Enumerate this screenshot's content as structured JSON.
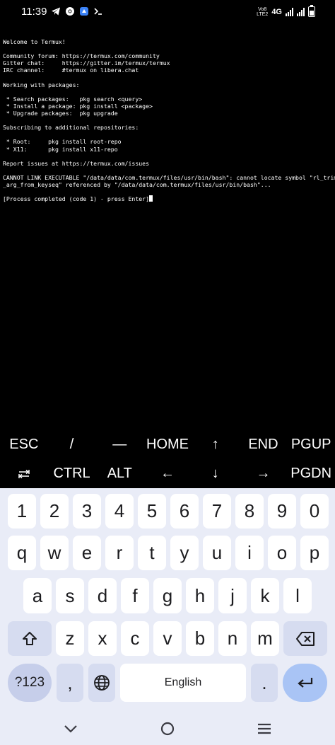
{
  "status_bar": {
    "time": "11:39",
    "volte_top": "Vo8",
    "volte_bottom": "LTE2",
    "network": "4G",
    "icons": [
      "telegram-icon",
      "chrome-icon",
      "app-store-icon",
      "termux-prompt-icon"
    ]
  },
  "terminal": {
    "lines": [
      "",
      "Welcome to Termux!",
      "",
      "Community forum: https://termux.com/community",
      "Gitter chat:     https://gitter.im/termux/termux",
      "IRC channel:     #termux on libera.chat",
      "",
      "Working with packages:",
      "",
      " * Search packages:   pkg search <query>",
      " * Install a package: pkg install <package>",
      " * Upgrade packages:  pkg upgrade",
      "",
      "Subscribing to additional repositories:",
      "",
      " * Root:     pkg install root-repo",
      " * X11:      pkg install x11-repo",
      "",
      "Report issues at https://termux.com/issues",
      "",
      "CANNOT LINK EXECUTABLE \"/data/data/com.termux/files/usr/bin/bash\": cannot locate symbol \"rl_trim",
      "_arg_from_keyseq\" referenced by \"/data/data/com.termux/files/usr/bin/bash\"...",
      "",
      "[Process completed (code 1) - press Enter]"
    ]
  },
  "extra_keys": {
    "row1": [
      "ESC",
      "/",
      "—",
      "HOME",
      "↑",
      "END",
      "PGUP"
    ],
    "row2": [
      "",
      "CTRL",
      "ALT",
      "←",
      "↓",
      "→",
      "PGDN"
    ]
  },
  "keyboard": {
    "numbers": [
      "1",
      "2",
      "3",
      "4",
      "5",
      "6",
      "7",
      "8",
      "9",
      "0"
    ],
    "row_q": [
      "q",
      "w",
      "e",
      "r",
      "t",
      "y",
      "u",
      "i",
      "o",
      "p"
    ],
    "row_a": [
      "a",
      "s",
      "d",
      "f",
      "g",
      "h",
      "j",
      "k",
      "l"
    ],
    "row_z": [
      "z",
      "x",
      "c",
      "v",
      "b",
      "n",
      "m"
    ],
    "symbols_label": "?123",
    "comma": ",",
    "space_label": "English",
    "period": "."
  },
  "colors": {
    "terminal_bg": "#000000",
    "keyboard_bg": "#e9ecf7",
    "enter_key": "#a9c4f5",
    "symbol_key": "#c6ceea"
  }
}
